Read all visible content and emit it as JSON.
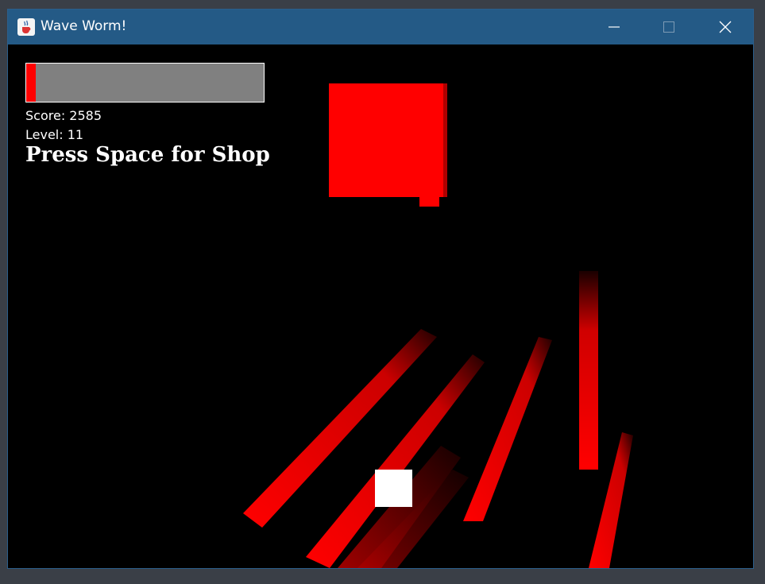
{
  "window": {
    "title": "Wave Worm!",
    "app_icon": "java-cup-icon",
    "controls": [
      "minimize-icon",
      "maximize-icon",
      "close-icon"
    ]
  },
  "hud": {
    "health_fraction": 0.04,
    "score_text": "Score: 2585",
    "level_text": "Level: 11",
    "shop_prompt": "Press Space for Shop"
  },
  "colors": {
    "titlebar": "#245a86",
    "enemy": "#ff0000",
    "health_fill": "#ff0000",
    "health_empty": "#808080",
    "player": "#ffffff",
    "background": "#000000"
  }
}
